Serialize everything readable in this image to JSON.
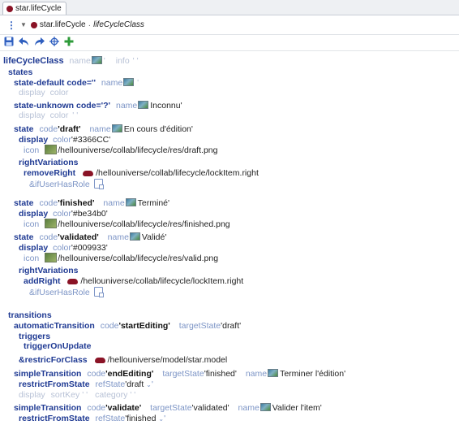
{
  "tab": {
    "label": "star.lifeCycle"
  },
  "breadcrumb": {
    "model": "star.lifeCycle",
    "separator": "·",
    "klass": "lifeCycleClass"
  },
  "doc": {
    "root": {
      "kw": "lifeCycleClass",
      "name_attr": "name",
      "name_val": "'",
      "info_attr": "info",
      "info_val": "' '"
    },
    "states_kw": "states",
    "state_default": {
      "kw": "state-default code=''",
      "name_attr": "name",
      "name_val": "'",
      "display_kw": "display",
      "color_attr": "color"
    },
    "state_unknown": {
      "kw": "state-unknown code='?'",
      "name_attr": "name",
      "name_val": "Inconnu'",
      "display_kw": "display",
      "color_attr": "color",
      "color_val": "' '"
    },
    "state_draft": {
      "kw": "state",
      "code_attr": "code",
      "code_val": "'draft'",
      "name_attr": "name",
      "name_val": "En cours d'édition'",
      "display_kw": "display",
      "color_attr": "color",
      "color_val": "'#3366CC'",
      "icon_attr": "icon",
      "icon_val": "/hellouniverse/collab/lifecycle/res/draft.png",
      "rv_kw": "rightVariations",
      "remove_kw": "removeRight",
      "remove_val": "/hellouniverse/collab/lifecycle/lockItem.right",
      "role_kw": "&ifUserHasRole"
    },
    "state_finished": {
      "kw": "state",
      "code_attr": "code",
      "code_val": "'finished'",
      "name_attr": "name",
      "name_val": "Terminé'",
      "display_kw": "display",
      "color_attr": "color",
      "color_val": "'#be34b0'",
      "icon_attr": "icon",
      "icon_val": "/hellouniverse/collab/lifecycle/res/finished.png"
    },
    "state_validated": {
      "kw": "state",
      "code_attr": "code",
      "code_val": "'validated'",
      "name_attr": "name",
      "name_val": "Validé'",
      "display_kw": "display",
      "color_attr": "color",
      "color_val": "'#009933'",
      "icon_attr": "icon",
      "icon_val": "/hellouniverse/collab/lifecycle/res/valid.png",
      "rv_kw": "rightVariations",
      "add_kw": "addRight",
      "add_val": "/hellouniverse/collab/lifecycle/lockItem.right",
      "role_kw": "&ifUserHasRole"
    },
    "transitions_kw": "transitions",
    "auto": {
      "kw": "automaticTransition",
      "code_attr": "code",
      "code_val": "'startEditing'",
      "target_attr": "targetState",
      "target_val": "'draft'",
      "triggers_kw": "triggers",
      "trigger_kw": "triggerOnUpdate",
      "restrict_kw": "&restricForClass",
      "restrict_val": "/hellouniverse/model/star.model"
    },
    "end_editing": {
      "kw": "simpleTransition",
      "code_attr": "code",
      "code_val": "'endEditing'",
      "target_attr": "targetState",
      "target_val": "'finished'",
      "name_attr": "name",
      "name_val": "Terminer l'édition'",
      "rfs_kw": "restrictFromState",
      "ref_attr": "refState",
      "ref_val": "'draft",
      "display_kw": "display",
      "sort_attr": "sortKey",
      "sort_val": "' '",
      "cat_attr": "category",
      "cat_val": "' '"
    },
    "validate": {
      "kw": "simpleTransition",
      "code_attr": "code",
      "code_val": "'validate'",
      "target_attr": "targetState",
      "target_val": "'validated'",
      "name_attr": "name",
      "name_val": "Valider l'item'",
      "rfs_kw": "restrictFromState",
      "ref_attr": "refState",
      "ref_val": "'finished"
    }
  }
}
